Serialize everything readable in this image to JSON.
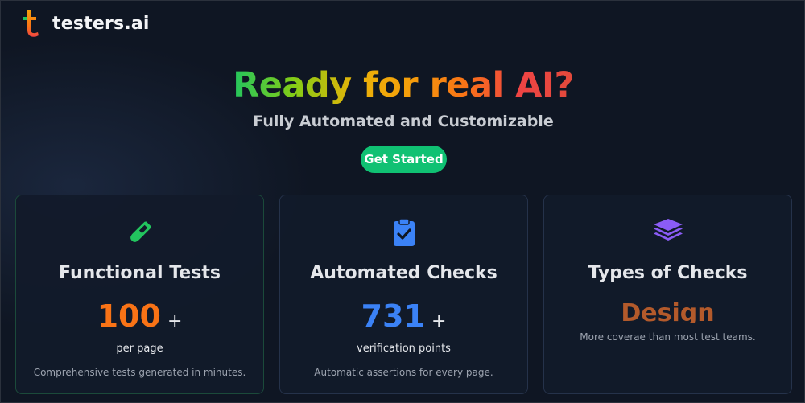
{
  "header": {
    "brand": "testers.ai",
    "logo_icon": "t-logo-icon"
  },
  "hero": {
    "title": "Ready for real AI?",
    "subtitle": "Fully Automated and Customizable",
    "cta_label": "Get Started"
  },
  "cards": [
    {
      "icon": "test-tube-icon",
      "title": "Functional Tests",
      "value": "100",
      "plus": "+",
      "label": "per page",
      "description": "Comprehensive tests generated in minutes."
    },
    {
      "icon": "clipboard-check-icon",
      "title": "Automated Checks",
      "value": "731",
      "plus": "+",
      "label": "verification points",
      "description": "Automatic assertions for every page."
    },
    {
      "icon": "layers-icon",
      "title": "Types of Checks",
      "rotating_word": "Design",
      "description": "More coverae than most test teams."
    }
  ],
  "colors": {
    "background": "#0f1623",
    "cta": "#10c173",
    "functional_value": "#f97316",
    "checks_value": "#3b82f6",
    "types_word": "#b35a2b"
  }
}
